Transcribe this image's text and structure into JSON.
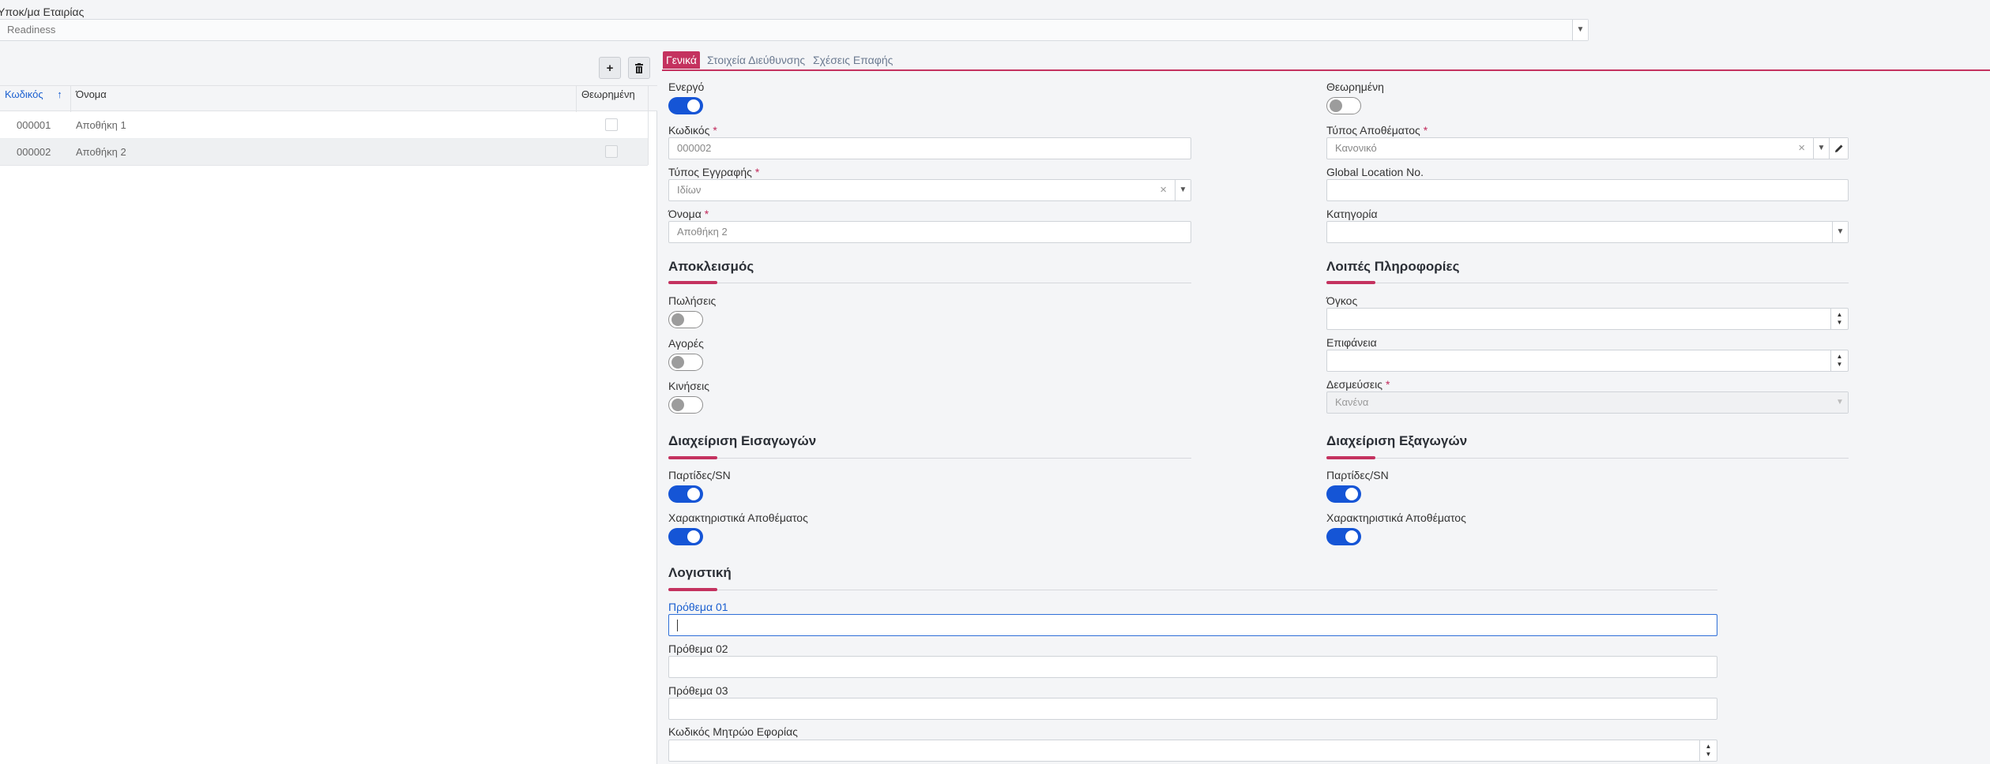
{
  "company": {
    "label": "Υποκ/μα Εταιρίας",
    "value": "Readiness"
  },
  "grid": {
    "columns": {
      "code": "Κωδικός",
      "name": "Όνομα",
      "considered": "Θεωρημένη"
    },
    "rows": [
      {
        "code": "000001",
        "name": "Αποθήκη 1"
      },
      {
        "code": "000002",
        "name": "Αποθήκη 2"
      }
    ]
  },
  "tabs": [
    "Γενικά",
    "Στοιχεία Διεύθυνσης",
    "Σχέσεις Επαφής"
  ],
  "form": {
    "active_label": "Ενεργό",
    "considered_label": "Θεωρημένη",
    "code_label": "Κωδικός",
    "code_value": "000002",
    "stock_type_label": "Τύπος Αποθέματος",
    "stock_type_value": "Κανονικό",
    "record_type_label": "Τύπος Εγγραφής",
    "record_type_value": "Ιδίων",
    "gln_label": "Global Location No.",
    "name_label": "Όνομα",
    "name_value": "Αποθήκη 2",
    "category_label": "Κατηγορία"
  },
  "exclusion": {
    "title": "Αποκλεισμός",
    "sales_label": "Πωλήσεις",
    "purchases_label": "Αγορές",
    "movements_label": "Κινήσεις"
  },
  "other_info": {
    "title": "Λοιπές Πληροφορίες",
    "volume_label": "Όγκος",
    "surface_label": "Επιφάνεια",
    "commitments_label": "Δεσμεύσεις",
    "commitments_value": "Κανένα"
  },
  "imports": {
    "title": "Διαχείριση Εισαγωγών",
    "lots_label": "Παρτίδες/SN",
    "attributes_label": "Χαρακτηριστικά Αποθέματος"
  },
  "exports": {
    "title": "Διαχείριση Εξαγωγών",
    "lots_label": "Παρτίδες/SN",
    "attributes_label": "Χαρακτηριστικά Αποθέματος"
  },
  "accounting": {
    "title": "Λογιστική",
    "prefix1_label": "Πρόθεμα 01",
    "prefix2_label": "Πρόθεμα 02",
    "prefix3_label": "Πρόθεμα 03",
    "tax_office_label": "Κωδικός Μητρώο Εφορίας"
  },
  "icons": {
    "sort": "arrow-up-icon",
    "add": "plus-icon",
    "delete": "trash-icon",
    "edit": "pencil-icon",
    "dropdown": "chevron-down-icon",
    "clear": "close-icon"
  },
  "colors": {
    "accent": "#c4325f",
    "primary": "#1555d6",
    "link": "#1a5fd0"
  }
}
